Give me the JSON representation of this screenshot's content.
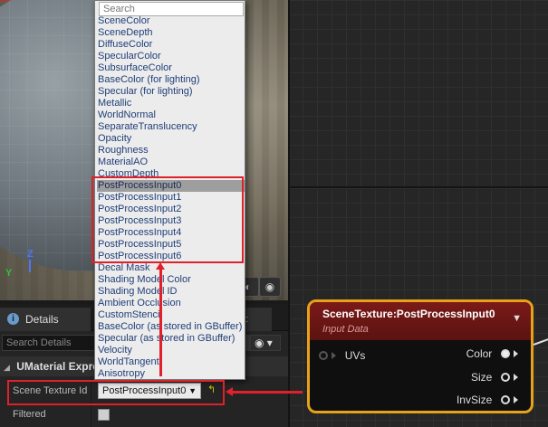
{
  "viewport": {
    "axis_z": "Z",
    "axis_y": "Y"
  },
  "details": {
    "tab_label": "Details",
    "other_tab": "lt:",
    "search_placeholder": "Search Details",
    "section_title": "UMaterial Expre",
    "rows": {
      "scene_texture_label": "Scene Texture Id",
      "scene_texture_value": "PostProcessInput0",
      "filtered_label": "Filtered"
    }
  },
  "dropdown": {
    "search_placeholder": "Search",
    "selected_index": 14,
    "items": [
      "SceneColor",
      "SceneDepth",
      "DiffuseColor",
      "SpecularColor",
      "SubsurfaceColor",
      "BaseColor (for lighting)",
      "Specular (for lighting)",
      "Metallic",
      "WorldNormal",
      "SeparateTranslucency",
      "Opacity",
      "Roughness",
      "MaterialAO",
      "CustomDepth",
      "PostProcessInput0",
      "PostProcessInput1",
      "PostProcessInput2",
      "PostProcessInput3",
      "PostProcessInput4",
      "PostProcessInput5",
      "PostProcessInput6",
      "Decal Mask",
      "Shading Model Color",
      "Shading Model ID",
      "Ambient Occlusion",
      "CustomStencil",
      "BaseColor (as stored in GBuffer)",
      "Specular (as stored in GBuffer)",
      "Velocity",
      "WorldTangent",
      "Anisotropy"
    ]
  },
  "node": {
    "title": "SceneTexture:PostProcessInput0",
    "subtitle": "Input Data",
    "input_pin": "UVs",
    "outputs": [
      "Color",
      "Size",
      "InvSize"
    ]
  },
  "colors": {
    "node_border": "#e8a21a",
    "node_header": "#7a1a18",
    "annotation_red": "#e0202a",
    "dropdown_text": "#1f3e78"
  },
  "icons": {
    "details_tab": "info-icon",
    "eye": "eye-icon",
    "reset": "reset-arrow-icon"
  }
}
